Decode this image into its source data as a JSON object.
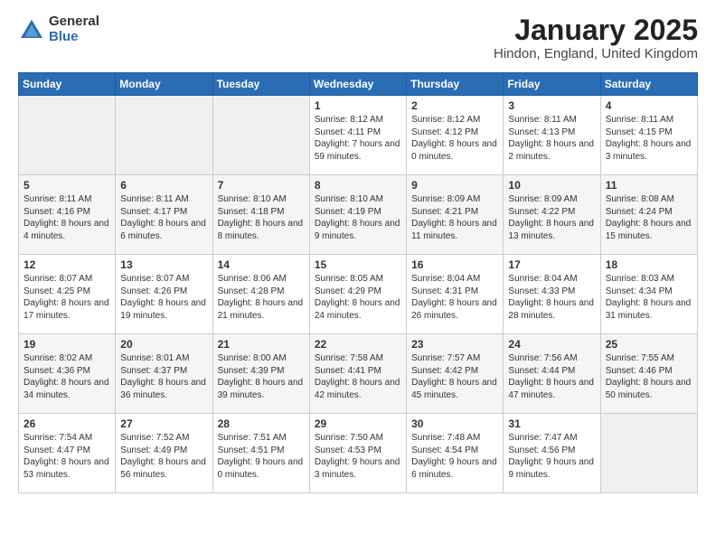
{
  "logo": {
    "general": "General",
    "blue": "Blue"
  },
  "header": {
    "title": "January 2025",
    "location": "Hindon, England, United Kingdom"
  },
  "weekdays": [
    "Sunday",
    "Monday",
    "Tuesday",
    "Wednesday",
    "Thursday",
    "Friday",
    "Saturday"
  ],
  "weeks": [
    [
      {
        "day": "",
        "empty": true
      },
      {
        "day": "",
        "empty": true
      },
      {
        "day": "",
        "empty": true
      },
      {
        "day": "1",
        "sunrise": "8:12 AM",
        "sunset": "4:11 PM",
        "daylight": "7 hours and 59 minutes."
      },
      {
        "day": "2",
        "sunrise": "8:12 AM",
        "sunset": "4:12 PM",
        "daylight": "8 hours and 0 minutes."
      },
      {
        "day": "3",
        "sunrise": "8:11 AM",
        "sunset": "4:13 PM",
        "daylight": "8 hours and 2 minutes."
      },
      {
        "day": "4",
        "sunrise": "8:11 AM",
        "sunset": "4:15 PM",
        "daylight": "8 hours and 3 minutes."
      }
    ],
    [
      {
        "day": "5",
        "sunrise": "8:11 AM",
        "sunset": "4:16 PM",
        "daylight": "8 hours and 4 minutes."
      },
      {
        "day": "6",
        "sunrise": "8:11 AM",
        "sunset": "4:17 PM",
        "daylight": "8 hours and 6 minutes."
      },
      {
        "day": "7",
        "sunrise": "8:10 AM",
        "sunset": "4:18 PM",
        "daylight": "8 hours and 8 minutes."
      },
      {
        "day": "8",
        "sunrise": "8:10 AM",
        "sunset": "4:19 PM",
        "daylight": "8 hours and 9 minutes."
      },
      {
        "day": "9",
        "sunrise": "8:09 AM",
        "sunset": "4:21 PM",
        "daylight": "8 hours and 11 minutes."
      },
      {
        "day": "10",
        "sunrise": "8:09 AM",
        "sunset": "4:22 PM",
        "daylight": "8 hours and 13 minutes."
      },
      {
        "day": "11",
        "sunrise": "8:08 AM",
        "sunset": "4:24 PM",
        "daylight": "8 hours and 15 minutes."
      }
    ],
    [
      {
        "day": "12",
        "sunrise": "8:07 AM",
        "sunset": "4:25 PM",
        "daylight": "8 hours and 17 minutes."
      },
      {
        "day": "13",
        "sunrise": "8:07 AM",
        "sunset": "4:26 PM",
        "daylight": "8 hours and 19 minutes."
      },
      {
        "day": "14",
        "sunrise": "8:06 AM",
        "sunset": "4:28 PM",
        "daylight": "8 hours and 21 minutes."
      },
      {
        "day": "15",
        "sunrise": "8:05 AM",
        "sunset": "4:29 PM",
        "daylight": "8 hours and 24 minutes."
      },
      {
        "day": "16",
        "sunrise": "8:04 AM",
        "sunset": "4:31 PM",
        "daylight": "8 hours and 26 minutes."
      },
      {
        "day": "17",
        "sunrise": "8:04 AM",
        "sunset": "4:33 PM",
        "daylight": "8 hours and 28 minutes."
      },
      {
        "day": "18",
        "sunrise": "8:03 AM",
        "sunset": "4:34 PM",
        "daylight": "8 hours and 31 minutes."
      }
    ],
    [
      {
        "day": "19",
        "sunrise": "8:02 AM",
        "sunset": "4:36 PM",
        "daylight": "8 hours and 34 minutes."
      },
      {
        "day": "20",
        "sunrise": "8:01 AM",
        "sunset": "4:37 PM",
        "daylight": "8 hours and 36 minutes."
      },
      {
        "day": "21",
        "sunrise": "8:00 AM",
        "sunset": "4:39 PM",
        "daylight": "8 hours and 39 minutes."
      },
      {
        "day": "22",
        "sunrise": "7:58 AM",
        "sunset": "4:41 PM",
        "daylight": "8 hours and 42 minutes."
      },
      {
        "day": "23",
        "sunrise": "7:57 AM",
        "sunset": "4:42 PM",
        "daylight": "8 hours and 45 minutes."
      },
      {
        "day": "24",
        "sunrise": "7:56 AM",
        "sunset": "4:44 PM",
        "daylight": "8 hours and 47 minutes."
      },
      {
        "day": "25",
        "sunrise": "7:55 AM",
        "sunset": "4:46 PM",
        "daylight": "8 hours and 50 minutes."
      }
    ],
    [
      {
        "day": "26",
        "sunrise": "7:54 AM",
        "sunset": "4:47 PM",
        "daylight": "8 hours and 53 minutes."
      },
      {
        "day": "27",
        "sunrise": "7:52 AM",
        "sunset": "4:49 PM",
        "daylight": "8 hours and 56 minutes."
      },
      {
        "day": "28",
        "sunrise": "7:51 AM",
        "sunset": "4:51 PM",
        "daylight": "9 hours and 0 minutes."
      },
      {
        "day": "29",
        "sunrise": "7:50 AM",
        "sunset": "4:53 PM",
        "daylight": "9 hours and 3 minutes."
      },
      {
        "day": "30",
        "sunrise": "7:48 AM",
        "sunset": "4:54 PM",
        "daylight": "9 hours and 6 minutes."
      },
      {
        "day": "31",
        "sunrise": "7:47 AM",
        "sunset": "4:56 PM",
        "daylight": "9 hours and 9 minutes."
      },
      {
        "day": "",
        "empty": true
      }
    ]
  ]
}
